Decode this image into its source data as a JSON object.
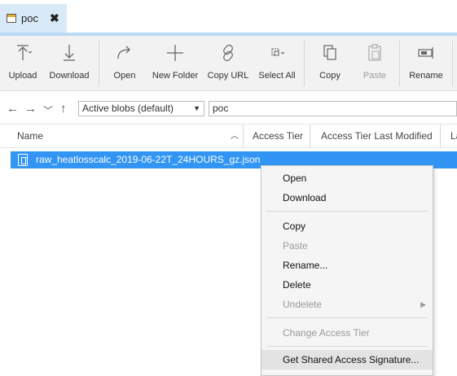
{
  "tab": {
    "title": "poc",
    "close": "✖"
  },
  "toolbar": {
    "upload": "Upload",
    "download": "Download",
    "open": "Open",
    "new_folder": "New Folder",
    "copy_url": "Copy URL",
    "select_all": "Select All",
    "copy": "Copy",
    "paste": "Paste",
    "rename": "Rename"
  },
  "address": {
    "filter": "Active blobs (default)",
    "path": "poc"
  },
  "columns": {
    "name": "Name",
    "access_tier": "Access Tier",
    "access_tier_modified": "Access Tier Last Modified",
    "last": "La"
  },
  "file": {
    "name": "raw_heatlosscalc_2019-06-22T_24HOURS_gz.json"
  },
  "context_menu": {
    "open": "Open",
    "download": "Download",
    "copy": "Copy",
    "paste": "Paste",
    "rename": "Rename...",
    "delete": "Delete",
    "undelete": "Undelete",
    "change_tier": "Change Access Tier",
    "get_sas": "Get Shared Access Signature..."
  }
}
